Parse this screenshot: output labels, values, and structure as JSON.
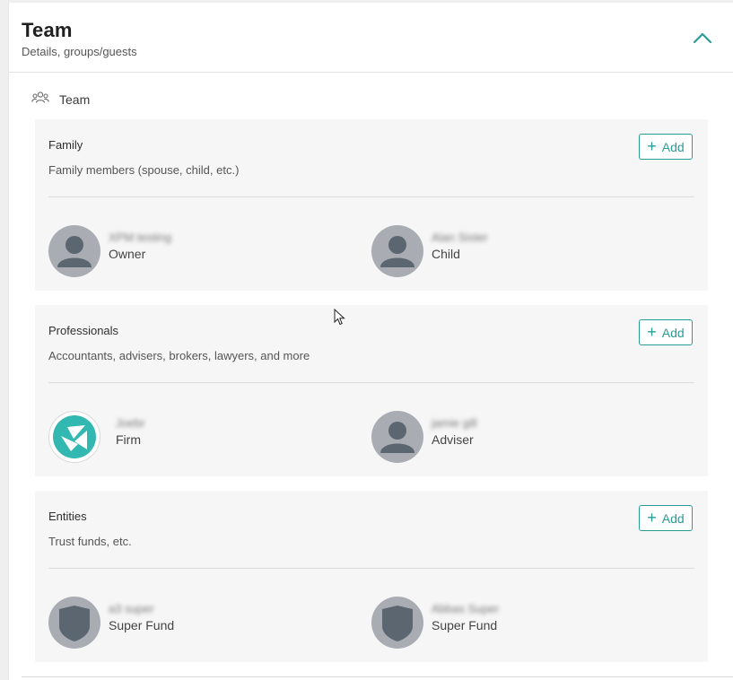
{
  "panel": {
    "title": "Team",
    "subtitle": "Details, groups/guests",
    "collapse_icon": "chevron-up-icon",
    "accent_color": "#2a9c96"
  },
  "team_heading": {
    "label": "Team",
    "icon": "people-icon"
  },
  "sections": [
    {
      "title": "Family",
      "description": "Family members (spouse, child, etc.)",
      "add_label": "Add",
      "members": [
        {
          "name": "XPM testing",
          "role": "Owner",
          "avatar": "person-avatar-icon"
        },
        {
          "name": "Alan Sister",
          "role": "Child",
          "avatar": "person-avatar-icon"
        }
      ]
    },
    {
      "title": "Professionals",
      "description": "Accountants, advisers, brokers, lawyers, and more",
      "add_label": "Add",
      "members": [
        {
          "name": "Joebr",
          "role": "Firm",
          "avatar": "firm-logo-icon"
        },
        {
          "name": "jamie gill",
          "role": "Adviser",
          "avatar": "person-avatar-icon"
        }
      ]
    },
    {
      "title": "Entities",
      "description": "Trust funds, etc.",
      "add_label": "Add",
      "members": [
        {
          "name": "a3 super",
          "role": "Super Fund",
          "avatar": "shield-avatar-icon"
        },
        {
          "name": "Abbas Super",
          "role": "Super Fund",
          "avatar": "shield-avatar-icon"
        }
      ]
    }
  ]
}
